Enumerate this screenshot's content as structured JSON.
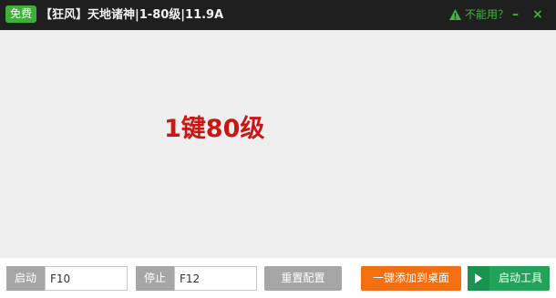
{
  "titlebar": {
    "badge": "免费",
    "title": "【狂风】天地诸神|1-80级|11.9A",
    "help_text": "不能用？",
    "minimize_label": "–",
    "close_label": "×"
  },
  "content": {
    "headline": "1键80级"
  },
  "controls": {
    "start_label": "启动",
    "start_hotkey": "F10",
    "stop_label": "停止",
    "stop_hotkey": "F12",
    "reset_label": "重置配置",
    "desktop_label": "一键添加到桌面",
    "launch_label": "启动工具"
  },
  "colors": {
    "titlebar_bg": "#1f1f1f",
    "accent_green": "#43b43f",
    "badge_green": "#3fae3b",
    "headline_red": "#cc1616",
    "orange": "#f26f12",
    "launch_green": "#22a35a",
    "gray_button": "#a6a6a6"
  },
  "icons": {
    "help": "warning-triangle-icon",
    "launch": "play-arrow-icon"
  }
}
